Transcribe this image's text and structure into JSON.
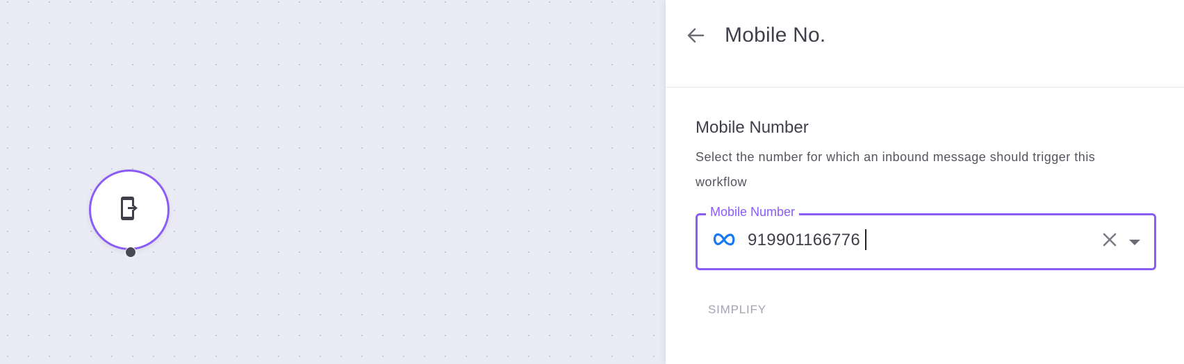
{
  "canvas": {
    "node_icon": "mobile-exit-icon"
  },
  "panel": {
    "back_icon": "arrow-left-icon",
    "title": "Mobile No.",
    "section_title": "Mobile Number",
    "section_description": "Select the number for which an inbound message should trigger this workflow",
    "field": {
      "label": "Mobile Number",
      "value": "919901166776",
      "provider_icon": "meta-icon",
      "clear_icon": "close-icon",
      "dropdown_icon": "caret-down-icon"
    },
    "simplify_label": "SIMPLIFY"
  },
  "colors": {
    "accent": "#8b5cf6",
    "canvas_bg": "#ebebf5",
    "text": "#3f3f4a",
    "meta_blue": "#1877f2"
  }
}
